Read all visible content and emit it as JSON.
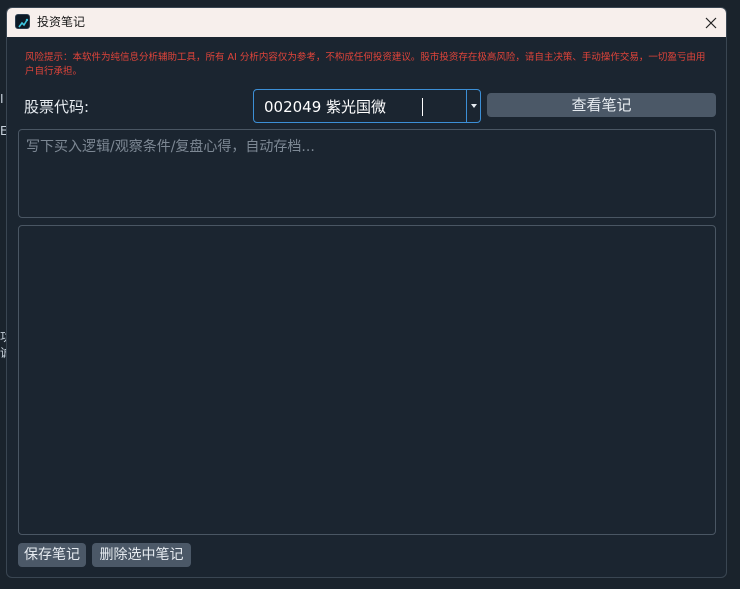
{
  "background": {
    "fragments": [
      "I",
      "E",
      "功",
      "诚"
    ]
  },
  "window": {
    "title": "投资笔记",
    "close_symbol": "✕"
  },
  "warning": {
    "text": "风险提示：本软件为纯信息分析辅助工具，所有 AI 分析内容仅为参考，不构成任何投资建议。股市投资存在极高风险，请自主决策、手动操作交易，一切盈亏由用户自行承担。"
  },
  "stock": {
    "label": "股票代码:",
    "selected": "002049 紫光国微"
  },
  "buttons": {
    "view_notes": "查看笔记",
    "save_note": "保存笔记",
    "delete_selected": "删除选中笔记"
  },
  "note_input": {
    "placeholder": "写下买入逻辑/观察条件/复盘心得，自动存档..."
  },
  "colors": {
    "accent_border": "#3c8fd6",
    "warning_text": "#e0443a",
    "button_bg": "#4b5867",
    "window_bg": "#1b2530",
    "titlebar_bg": "#f7efec"
  }
}
